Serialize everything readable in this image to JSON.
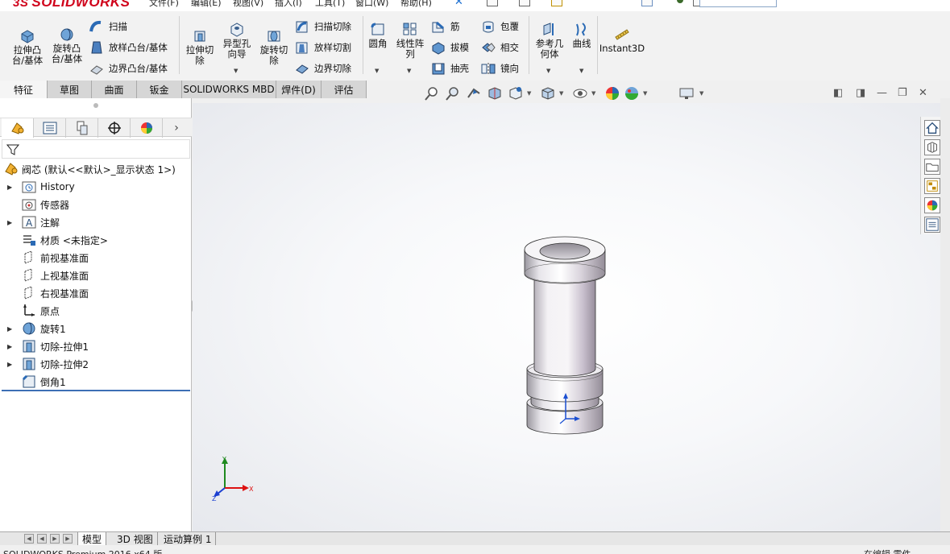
{
  "app": {
    "logo_text": "SOLIDWORKS",
    "logo_mark": "3S"
  },
  "menu": {
    "items": [
      "文件(F)",
      "编辑(E)",
      "视图(V)",
      "插入(I)",
      "工具(T)",
      "窗口(W)",
      "帮助(H)"
    ]
  },
  "toolbar": {
    "extrude_boss": "拉伸凸\n台/基体",
    "revolve_boss": "旋转凸\n台/基体",
    "sweep": "扫描",
    "loft_boss": "放样凸台/基体",
    "boundary_boss": "边界凸台/基体",
    "extrude_cut": "拉伸切\n除",
    "hole_wizard": "异型孔\n向导",
    "revolve_cut": "旋转切\n除",
    "swept_cut": "扫描切除",
    "lofted_cut": "放样切割",
    "boundary_cut": "边界切除",
    "fillet": "圆角",
    "linear_pattern": "线性阵\n列",
    "rib": "筋",
    "draft": "拔模",
    "shell": "抽壳",
    "wrap": "包覆",
    "intersect": "相交",
    "mirror": "镜向",
    "ref_geometry": "参考几\n何体",
    "curves": "曲线",
    "instant3d": "Instant3D"
  },
  "tabs": [
    {
      "label": "特征",
      "active": true
    },
    {
      "label": "草图",
      "active": false
    },
    {
      "label": "曲面",
      "active": false
    },
    {
      "label": "钣金",
      "active": false
    },
    {
      "label": "SOLIDWORKS MBD",
      "active": false
    },
    {
      "label": "焊件(D)",
      "active": false
    },
    {
      "label": "评估",
      "active": false
    }
  ],
  "feature_tree": {
    "root": "阀芯  (默认<<默认>_显示状态 1>)",
    "items": [
      {
        "label": "History",
        "expandable": true,
        "icon": "history-folder-icon"
      },
      {
        "label": "传感器",
        "expandable": false,
        "icon": "sensors-icon"
      },
      {
        "label": "注解",
        "expandable": true,
        "icon": "annotations-icon"
      },
      {
        "label": "材质 <未指定>",
        "expandable": false,
        "icon": "material-icon"
      },
      {
        "label": "前视基准面",
        "expandable": false,
        "icon": "plane-icon"
      },
      {
        "label": "上视基准面",
        "expandable": false,
        "icon": "plane-icon"
      },
      {
        "label": "右视基准面",
        "expandable": false,
        "icon": "plane-icon"
      },
      {
        "label": "原点",
        "expandable": false,
        "icon": "origin-icon"
      },
      {
        "label": "旋转1",
        "expandable": true,
        "icon": "revolve-feature-icon"
      },
      {
        "label": "切除-拉伸1",
        "expandable": true,
        "icon": "cut-extrude-icon"
      },
      {
        "label": "切除-拉伸2",
        "expandable": true,
        "icon": "cut-extrude-icon"
      },
      {
        "label": "倒角1",
        "expandable": false,
        "icon": "chamfer-icon"
      }
    ]
  },
  "triad": {
    "x": "X",
    "y": "Y",
    "z": "Z"
  },
  "bottom_tabs": [
    {
      "label": "模型",
      "active": true
    },
    {
      "label": "3D 视图",
      "active": false
    },
    {
      "label": "运动算例 1",
      "active": false
    }
  ],
  "status": {
    "left": "SOLIDWORKS Premium 2016 x64 版",
    "right": "在编辑 零件"
  },
  "colors": {
    "accent": "#1b6fd1",
    "logo_red": "#d0021b",
    "tree_highlight": "#3d6fb5"
  }
}
